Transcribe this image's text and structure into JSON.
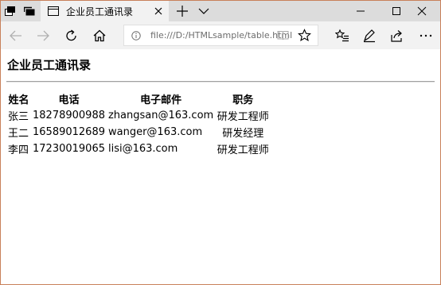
{
  "browser": {
    "tab": {
      "title": "企业员工通讯录"
    },
    "address": {
      "url": "file:///D:/HTMLsample/table.html"
    },
    "icons": {
      "tab_actions": "tab-set-aside-icon",
      "tab_preview": "tab-preview-icon",
      "favicon": "page-icon",
      "close_tab": "close-icon",
      "new_tab": "plus-icon",
      "tab_list": "chevron-down-icon",
      "minimize": "minimize-icon",
      "maximize": "maximize-icon",
      "close_window": "close-icon",
      "back": "arrow-left-icon",
      "forward": "arrow-right-icon",
      "refresh": "refresh-icon",
      "home": "home-icon",
      "info": "info-icon",
      "reading_view": "book-icon",
      "favorite": "star-icon",
      "favorites_hub": "favorites-list-icon",
      "notes": "pen-icon",
      "share": "share-icon",
      "more": "more-icon"
    }
  },
  "page": {
    "title": "企业员工通讯录",
    "table": {
      "headers": [
        "姓名",
        "电话",
        "电子邮件",
        "职务"
      ],
      "rows": [
        [
          "张三",
          "18278900988",
          "zhangsan@163.com",
          "研发工程师"
        ],
        [
          "王二",
          "16589012689",
          "wanger@163.com",
          "研发经理"
        ],
        [
          "李四",
          "17230019065",
          "lisi@163.com",
          "研发工程师"
        ]
      ]
    }
  }
}
